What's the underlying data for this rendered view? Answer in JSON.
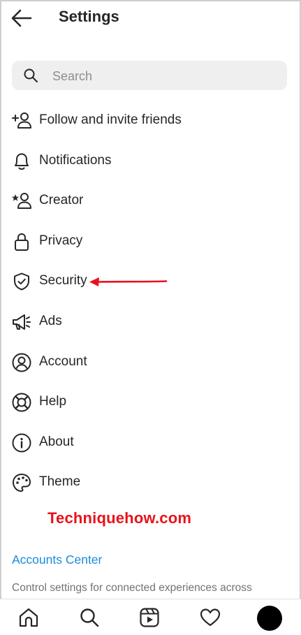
{
  "header": {
    "title": "Settings",
    "back_icon": "arrow-left-icon"
  },
  "search": {
    "placeholder": "Search",
    "value": "",
    "icon": "search-icon"
  },
  "menu": {
    "items": [
      {
        "label": "Follow and invite friends",
        "icon": "add-person-icon"
      },
      {
        "label": "Notifications",
        "icon": "bell-icon"
      },
      {
        "label": "Creator",
        "icon": "star-person-icon"
      },
      {
        "label": "Privacy",
        "icon": "lock-icon"
      },
      {
        "label": "Security",
        "icon": "shield-check-icon"
      },
      {
        "label": "Ads",
        "icon": "megaphone-icon"
      },
      {
        "label": "Account",
        "icon": "account-circle-icon"
      },
      {
        "label": "Help",
        "icon": "lifebuoy-icon"
      },
      {
        "label": "About",
        "icon": "info-icon"
      },
      {
        "label": "Theme",
        "icon": "palette-icon"
      }
    ]
  },
  "annotation": {
    "arrow_color": "#e8121b",
    "points_to": "Security"
  },
  "watermark": {
    "text": "Techniquehow.com",
    "color": "#e8121b"
  },
  "accounts_center": {
    "link": "Accounts Center",
    "description": "Control settings for connected experiences across",
    "link_color": "#1a8cd8"
  },
  "bottom_nav": {
    "items": [
      "home-icon",
      "search-icon",
      "reels-icon",
      "heart-icon",
      "profile-avatar"
    ]
  }
}
